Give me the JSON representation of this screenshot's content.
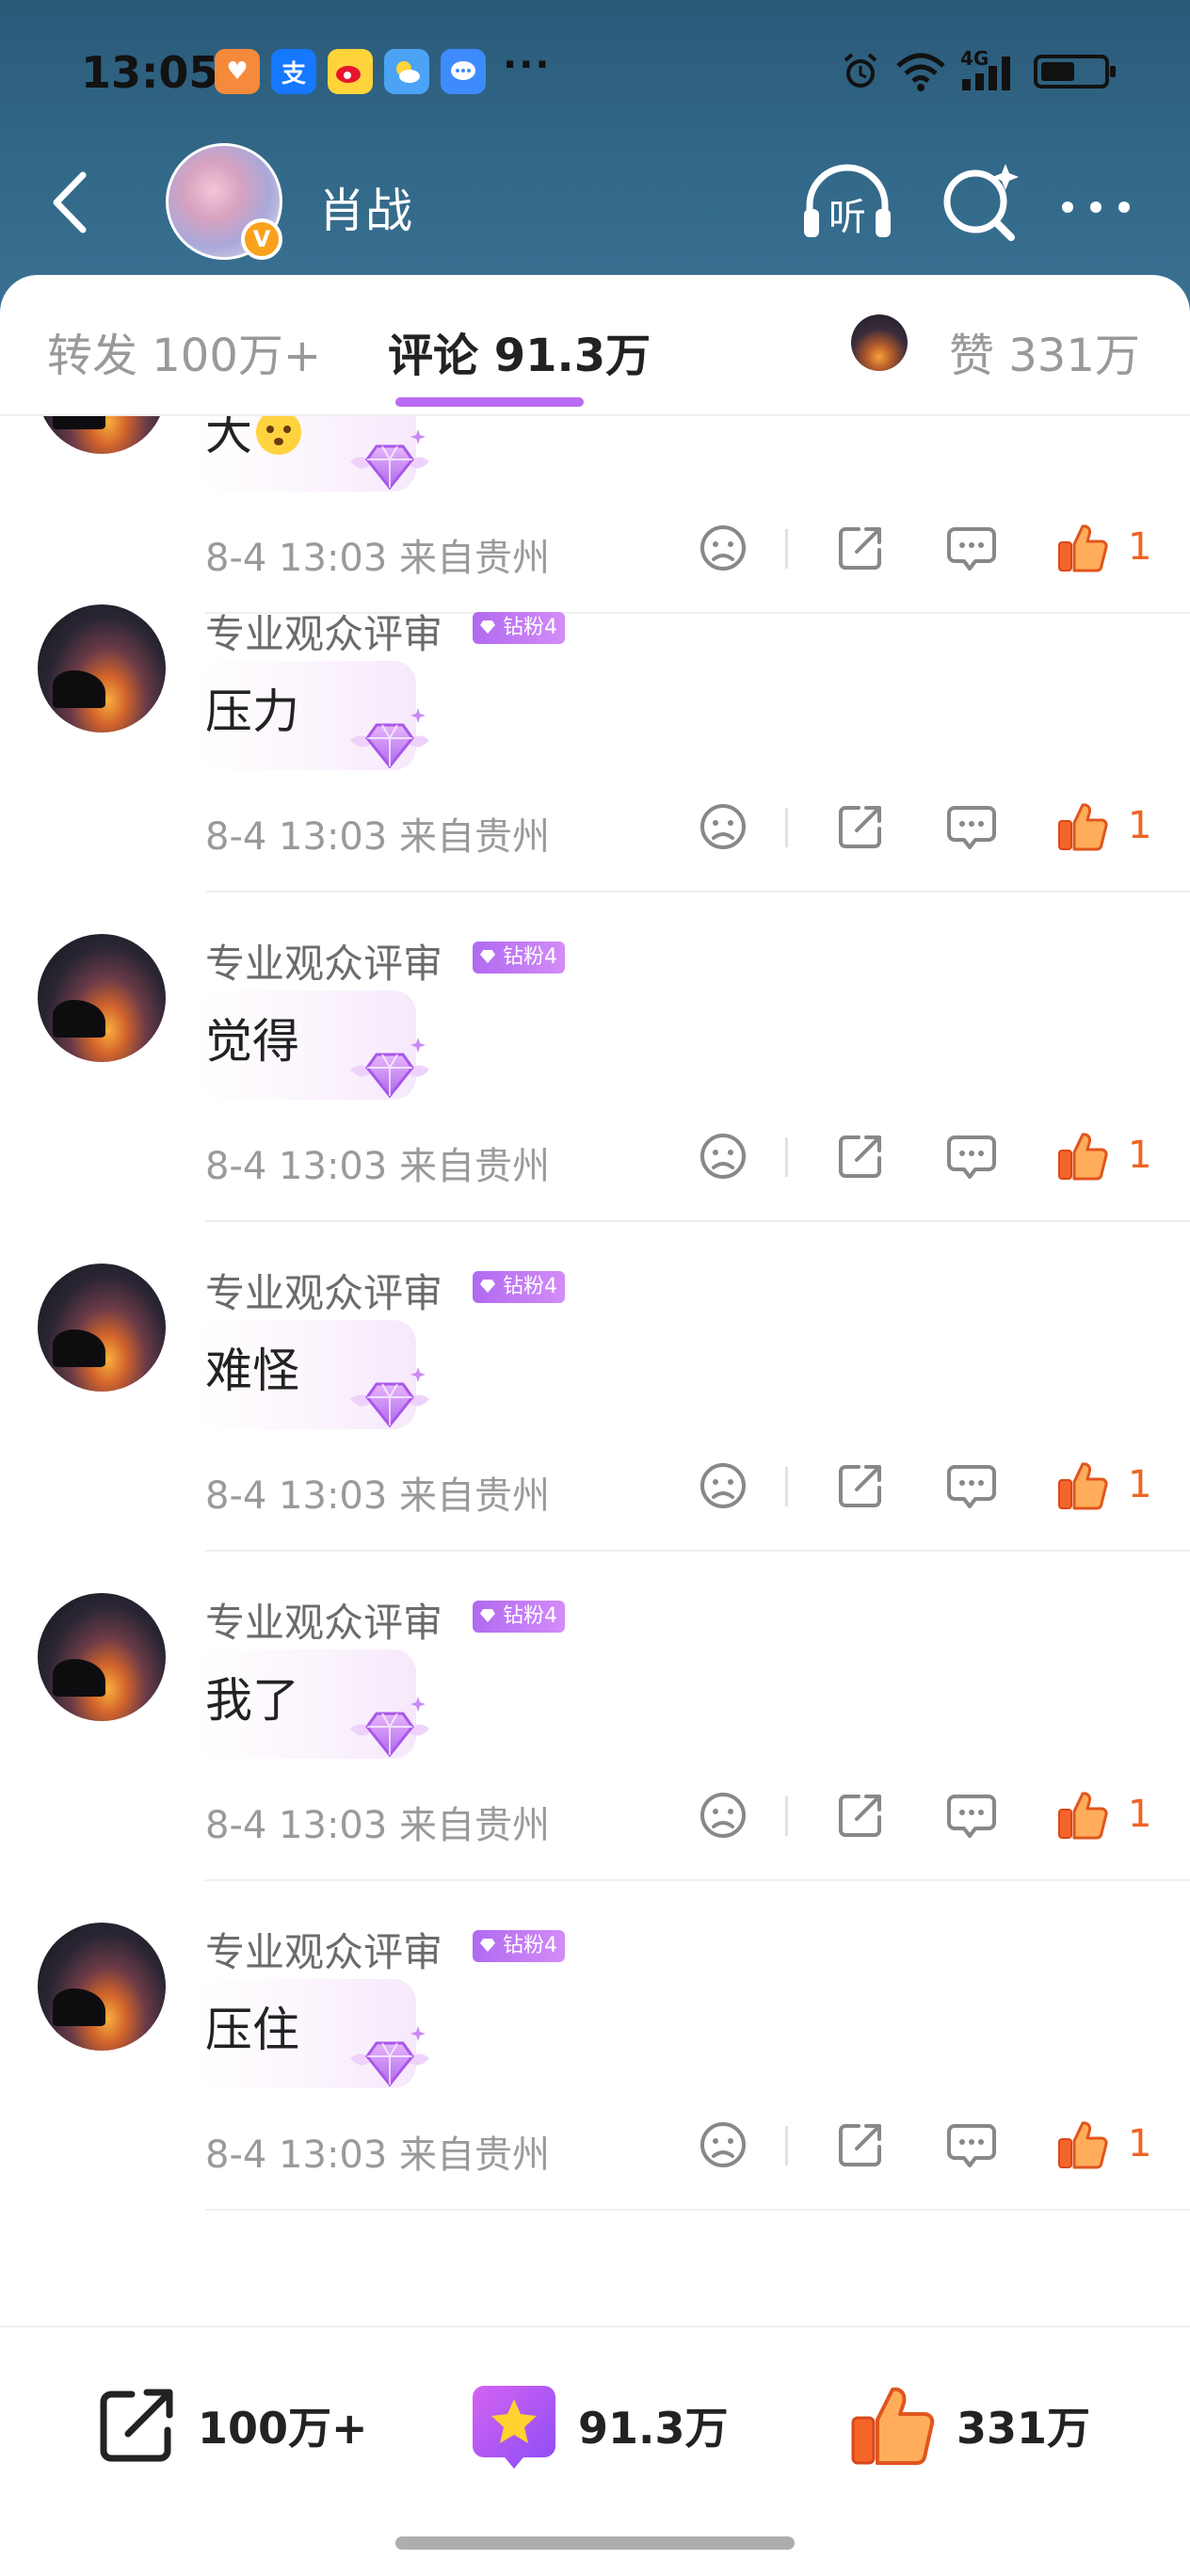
{
  "status_bar": {
    "time": "13:05",
    "more": "···",
    "app_icons": [
      "health-app-icon",
      "alipay-icon",
      "weibo-icon",
      "weather-icon",
      "message-icon"
    ],
    "network": "4G",
    "battery_level": 0.55
  },
  "nav": {
    "title": "肖战",
    "listen_label": "听",
    "verified_mark": "V"
  },
  "tabs": {
    "repost": "转发 100万+",
    "comments": "评论 91.3万",
    "likes": "赞 331万"
  },
  "comments": [
    {
      "name": "",
      "text": "大",
      "time": "8-4 13:03",
      "location": "来自贵州",
      "likes": "1",
      "has_emoji": true
    },
    {
      "name": "专业观众评审",
      "badge": "钻粉4",
      "text": "压力",
      "time": "8-4 13:03",
      "location": "来自贵州",
      "likes": "1"
    },
    {
      "name": "专业观众评审",
      "badge": "钻粉4",
      "text": "觉得",
      "time": "8-4 13:03",
      "location": "来自贵州",
      "likes": "1"
    },
    {
      "name": "专业观众评审",
      "badge": "钻粉4",
      "text": "难怪",
      "time": "8-4 13:03",
      "location": "来自贵州",
      "likes": "1"
    },
    {
      "name": "专业观众评审",
      "badge": "钻粉4",
      "text": "我了",
      "time": "8-4 13:03",
      "location": "来自贵州",
      "likes": "1"
    },
    {
      "name": "专业观众评审",
      "badge": "钻粉4",
      "text": "压住",
      "time": "8-4 13:03",
      "location": "来自贵州",
      "likes": "1"
    }
  ],
  "bottom_bar": {
    "repost": "100万+",
    "comment": "91.3万",
    "like": "331万"
  },
  "colors": {
    "header": "#336a8a",
    "accent_purple": "#b96cf2",
    "like_orange": "#ee6524"
  }
}
